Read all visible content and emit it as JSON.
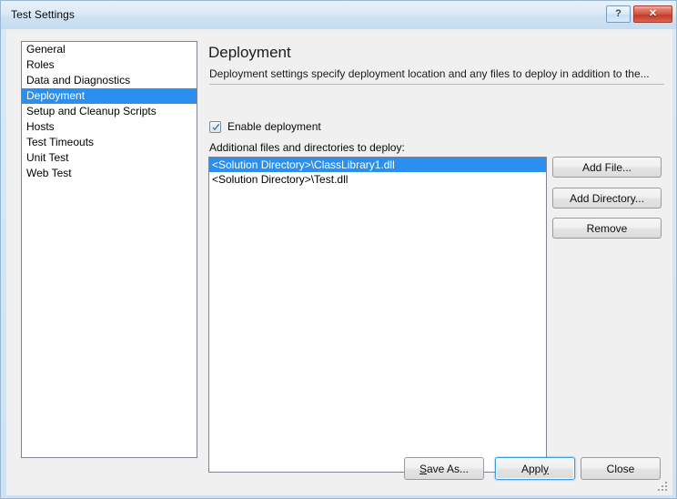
{
  "window": {
    "title": "Test Settings",
    "help_button": "?",
    "close_button": "✕",
    "accent_selection": "#2a8fef",
    "close_button_color": "#c0392b"
  },
  "sidebar": {
    "items": [
      {
        "label": "General",
        "selected": false
      },
      {
        "label": "Roles",
        "selected": false
      },
      {
        "label": "Data and Diagnostics",
        "selected": false
      },
      {
        "label": "Deployment",
        "selected": true
      },
      {
        "label": "Setup and Cleanup Scripts",
        "selected": false
      },
      {
        "label": "Hosts",
        "selected": false
      },
      {
        "label": "Test Timeouts",
        "selected": false
      },
      {
        "label": "Unit Test",
        "selected": false
      },
      {
        "label": "Web Test",
        "selected": false
      }
    ]
  },
  "pane": {
    "title": "Deployment",
    "description": "Deployment settings specify deployment location and any files to deploy in addition to the...",
    "enable_deployment": {
      "label": "Enable deployment",
      "checked": true
    },
    "files_label": "Additional files and directories to deploy:",
    "files": [
      {
        "path": "<Solution Directory>\\ClassLibrary1.dll",
        "selected": true
      },
      {
        "path": "<Solution Directory>\\Test.dll",
        "selected": false
      }
    ],
    "side_buttons": {
      "add_file": "Add File...",
      "add_directory": "Add Directory...",
      "remove": "Remove"
    }
  },
  "footer": {
    "save_as": {
      "prefix": "",
      "accel": "S",
      "suffix": "ave As..."
    },
    "apply": {
      "prefix": "Appl",
      "accel": "y",
      "suffix": ""
    },
    "close": "Close"
  }
}
